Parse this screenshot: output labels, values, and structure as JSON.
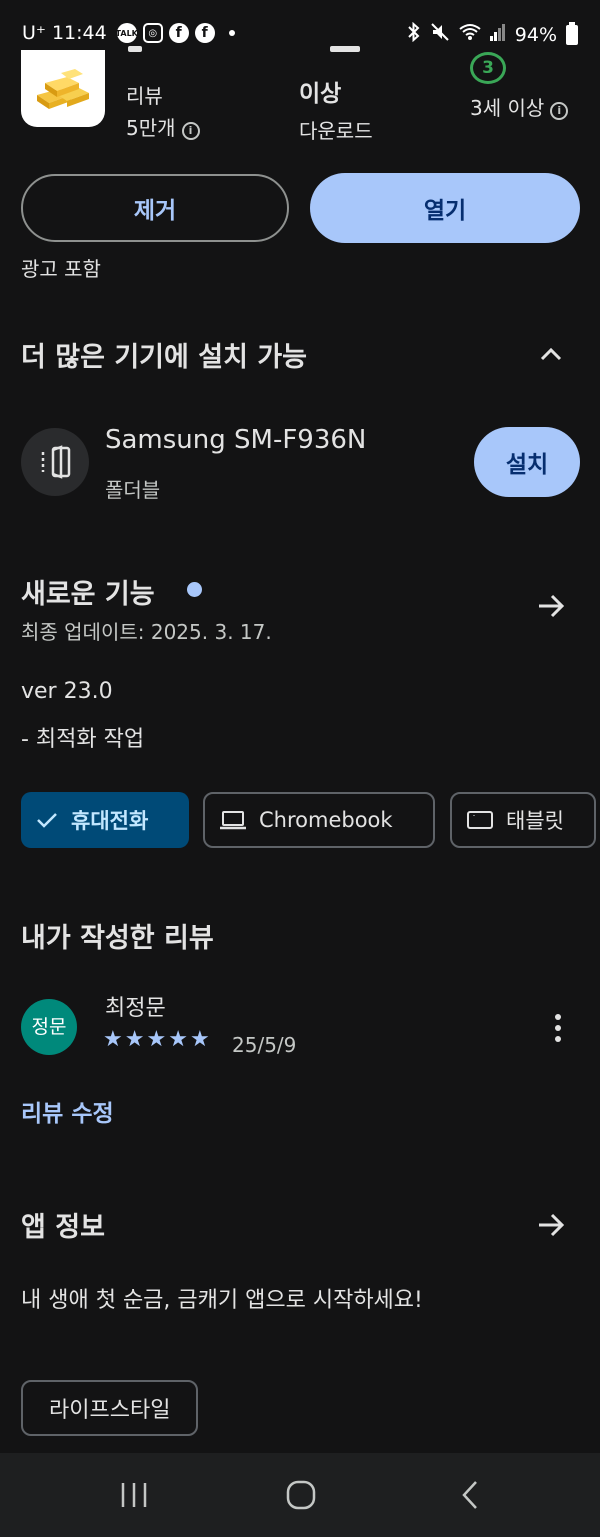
{
  "status_bar": {
    "carrier": "U⁺",
    "time": "11:44",
    "notification_icons": [
      "kakaotalk-icon",
      "instagram-icon",
      "facebook-icon",
      "facebook-icon"
    ],
    "talk_label": "TALK",
    "battery": "94%"
  },
  "app_header": {
    "reviews_label": "리뷰",
    "reviews_count": "5만개",
    "downloads_value": "이상",
    "downloads_label": "다운로드",
    "age_badge": "3",
    "age_label": "3세 이상"
  },
  "actions": {
    "remove_label": "제거",
    "open_label": "열기",
    "ads_note": "광고 포함"
  },
  "more_devices": {
    "title": "더 많은 기기에 설치 가능",
    "device_name": "Samsung SM-F936N",
    "device_type": "폴더블",
    "install_label": "설치"
  },
  "whats_new": {
    "title": "새로운 기능",
    "updated": "최종 업데이트: 2025. 3. 17.",
    "version": "ver 23.0",
    "notes": "- 최적화 작업"
  },
  "device_chips": [
    {
      "label": "휴대전화",
      "selected": true
    },
    {
      "label": "Chromebook",
      "selected": false
    },
    {
      "label": "태블릿",
      "selected": false
    }
  ],
  "my_review": {
    "title": "내가 작성한 리뷰",
    "avatar_text": "정문",
    "reviewer": "최정문",
    "rating": 5,
    "stars": [
      "★",
      "★",
      "★",
      "★",
      "★"
    ],
    "date": "25/5/9",
    "edit_label": "리뷰 수정"
  },
  "about_app": {
    "title": "앱 정보",
    "description": "내 생애 첫 순금, 금캐기 앱으로 시작하세요!",
    "category": "라이프스타일"
  },
  "colors": {
    "background": "#131314",
    "accent": "#a8c7fa",
    "selected_chip": "#004a77",
    "age_badge": "#3aa757",
    "avatar": "#00897b"
  }
}
